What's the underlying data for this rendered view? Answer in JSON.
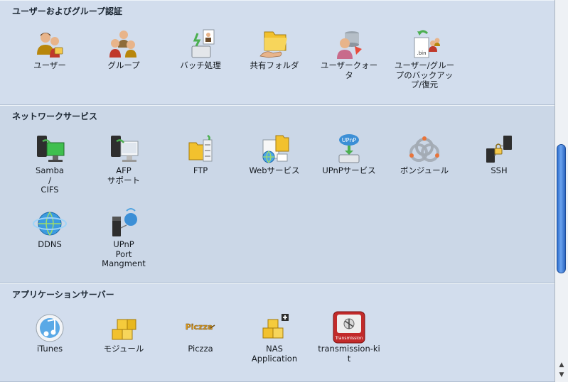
{
  "sections": [
    {
      "title": "ユーザーおよびグループ認証",
      "items": [
        {
          "label": "ユーザー",
          "icon": "user-icon"
        },
        {
          "label": "グループ",
          "icon": "group-icon"
        },
        {
          "label": "バッチ処理",
          "icon": "batch-process-icon"
        },
        {
          "label": "共有フォルダ",
          "icon": "shared-folder-icon"
        },
        {
          "label": "ユーザークォータ",
          "icon": "user-quota-icon"
        },
        {
          "label": "ユーザー/グループのバックアップ/復元",
          "icon": "backup-restore-icon"
        }
      ]
    },
    {
      "title": "ネットワークサービス",
      "items": [
        {
          "label": "Samba\n/\nCIFS",
          "icon": "samba-cifs-icon"
        },
        {
          "label": "AFP\nサポート",
          "icon": "afp-support-icon"
        },
        {
          "label": "FTP",
          "icon": "ftp-icon"
        },
        {
          "label": "Webサービス",
          "icon": "web-service-icon"
        },
        {
          "label": "UPnPサービス",
          "icon": "upnp-service-icon"
        },
        {
          "label": "ボンジュール",
          "icon": "bonjour-icon"
        },
        {
          "label": "SSH",
          "icon": "ssh-icon"
        },
        {
          "label": "DDNS",
          "icon": "ddns-icon"
        },
        {
          "label": "UPnP\nPort\nMangment",
          "icon": "upnp-port-icon"
        }
      ]
    },
    {
      "title": "アプリケーションサーバー",
      "items": [
        {
          "label": "iTunes",
          "icon": "itunes-icon"
        },
        {
          "label": "モジュール",
          "icon": "module-icon"
        },
        {
          "label": "Piczza",
          "icon": "piczza-icon"
        },
        {
          "label": "NAS\nApplication",
          "icon": "nas-application-icon"
        },
        {
          "label": "transmission-kit",
          "icon": "transmission-kit-icon"
        }
      ]
    }
  ],
  "icon_texts": {
    "bin": ".bin",
    "upnp": "UPnP",
    "piczza": "Piczza",
    "transmission": "Transmission"
  },
  "colors": {
    "background": "#cdd9e8",
    "scroll_thumb": "#3a7bd5"
  }
}
